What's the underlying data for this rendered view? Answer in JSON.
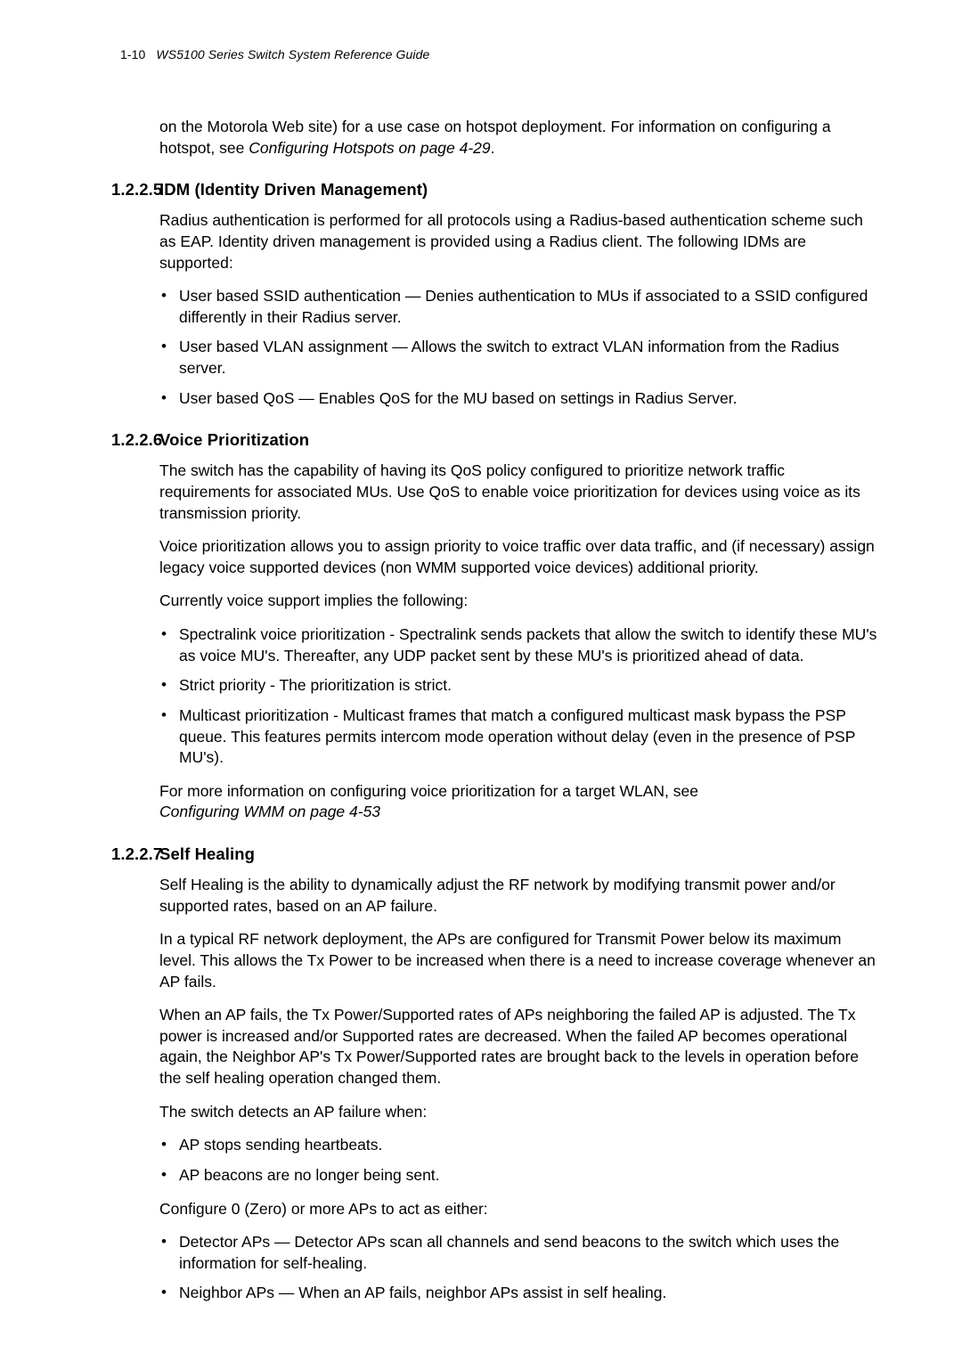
{
  "header": {
    "page_number": "1-10",
    "guide_title": "WS5100 Series Switch System Reference Guide"
  },
  "intro": {
    "line1": "on the Motorola Web site) for a use case on hotspot deployment. For information on configuring a hotspot, see ",
    "ref": "Configuring Hotspots on page 4-29",
    "period": "."
  },
  "s1": {
    "num": "1.2.2.5",
    "title": "IDM (Identity Driven Management)",
    "p1": "Radius authentication is performed for all protocols using a Radius-based authentication scheme such as EAP. Identity driven management is provided using a Radius client. The following IDMs are supported:",
    "b1": "User based SSID authentication — Denies authentication to MUs if associated to a SSID configured differently in their Radius server.",
    "b2": "User based VLAN assignment — Allows the switch to extract VLAN information from the Radius server.",
    "b3": "User based QoS — Enables QoS for the MU based on settings in Radius Server."
  },
  "s2": {
    "num": "1.2.2.6",
    "title": "Voice Prioritization",
    "p1": "The switch has the capability of having its QoS policy configured to prioritize network traffic requirements for associated MUs. Use QoS to enable voice prioritization for devices using voice as its transmission priority.",
    "p2": "Voice prioritization allows you to assign priority to voice traffic over data traffic, and (if necessary) assign legacy voice supported devices (non WMM supported voice devices) additional priority.",
    "p3": "Currently voice support implies the following:",
    "b1": "Spectralink voice prioritization - Spectralink sends packets that allow the switch to identify these MU's as voice MU's. Thereafter, any UDP packet sent by these MU's is prioritized ahead of data.",
    "b2": "Strict priority - The prioritization is strict.",
    "b3": "Multicast prioritization - Multicast frames that match a configured multicast mask bypass the PSP queue. This features permits intercom mode operation without delay (even in the presence of PSP MU's).",
    "p4_pre": "For more information on configuring voice prioritization for a target WLAN, see",
    "p4_ref": "Configuring WMM on page 4-53"
  },
  "s3": {
    "num": "1.2.2.7",
    "title": "Self Healing",
    "p1": "Self Healing is the ability to dynamically adjust the RF network by modifying transmit power and/or supported rates, based on an AP failure.",
    "p2": "In a typical RF network deployment, the APs are configured for Transmit Power below its maximum level. This allows the Tx Power to be increased when there is a need to increase coverage whenever an AP fails.",
    "p3": "When an AP fails, the Tx Power/Supported rates of APs neighboring the failed AP is adjusted. The Tx power is increased and/or Supported rates are decreased. When the failed AP becomes operational again, the Neighbor AP's Tx Power/Supported rates are brought back to the levels in operation before the self healing operation changed them.",
    "p4": "The switch detects an AP failure when:",
    "b1": "AP stops sending heartbeats.",
    "b2": "AP beacons are no longer being sent.",
    "p5": "Configure 0 (Zero) or more APs to act as either:",
    "b3": "Detector APs — Detector APs scan all channels and send beacons to the switch which uses the information for self-healing.",
    "b4": "Neighbor APs — When an AP fails, neighbor APs assist in self healing."
  }
}
